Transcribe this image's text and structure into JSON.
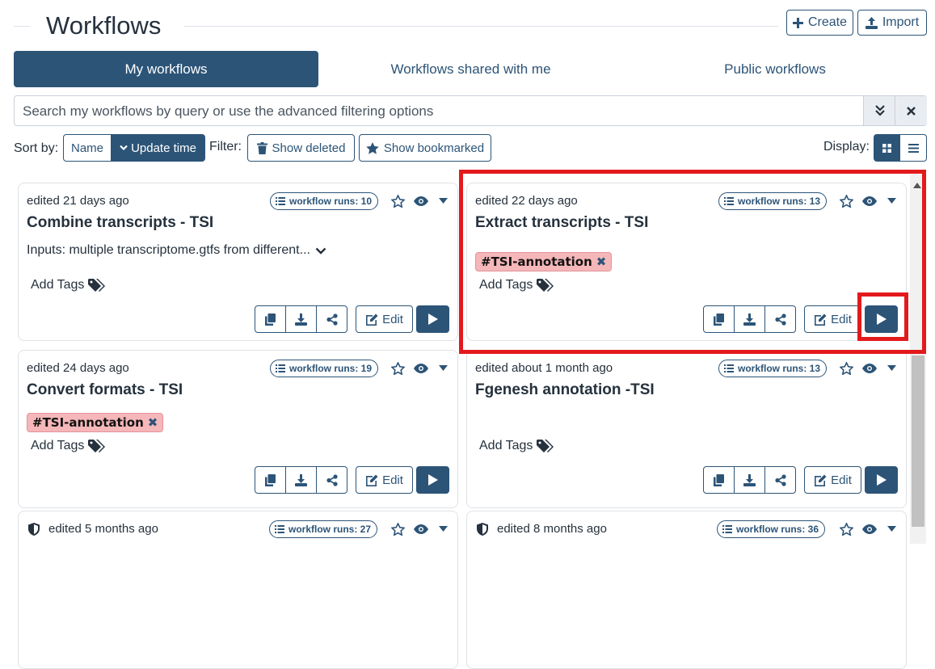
{
  "header": {
    "title": "Workflows",
    "create_label": "Create",
    "import_label": "Import"
  },
  "tabs": [
    {
      "label": "My workflows",
      "active": true
    },
    {
      "label": "Workflows shared with me",
      "active": false
    },
    {
      "label": "Public workflows",
      "active": false
    }
  ],
  "search": {
    "placeholder": "Search my workflows by query or use the advanced filtering options",
    "value": ""
  },
  "toolbar": {
    "sort_by_label": "Sort by:",
    "sort_name_label": "Name",
    "sort_time_label": "Update time",
    "filter_label": "Filter:",
    "show_deleted_label": "Show deleted",
    "show_bookmarked_label": "Show bookmarked",
    "display_label": "Display:"
  },
  "cards": [
    {
      "edited": "edited 21 days ago",
      "runs": "workflow runs: 10",
      "title": "Combine transcripts - TSI",
      "description": "Inputs: multiple transcriptome.gtfs from different...",
      "tag": "",
      "add_tags": "Add Tags",
      "edit": "Edit"
    },
    {
      "edited": "edited 22 days ago",
      "runs": "workflow runs: 13",
      "title": "Extract transcripts - TSI",
      "description": "",
      "tag": "#TSI-annotation",
      "add_tags": "Add Tags",
      "edit": "Edit"
    },
    {
      "edited": "edited 24 days ago",
      "runs": "workflow runs: 19",
      "title": "Convert formats - TSI",
      "description": "",
      "tag": "#TSI-annotation",
      "add_tags": "Add Tags",
      "edit": "Edit"
    },
    {
      "edited": "edited about 1 month ago",
      "runs": "workflow runs: 13",
      "title": "Fgenesh annotation -TSI",
      "description": "",
      "tag": "",
      "add_tags": "Add Tags",
      "edit": "Edit"
    },
    {
      "edited": "edited 5 months ago",
      "runs": "workflow runs: 27"
    },
    {
      "edited": "edited 8 months ago",
      "runs": "workflow runs: 36"
    }
  ],
  "colors": {
    "primary": "#2c5477",
    "tag_bg": "#f5b7b9",
    "highlight": "#e31a1c"
  }
}
